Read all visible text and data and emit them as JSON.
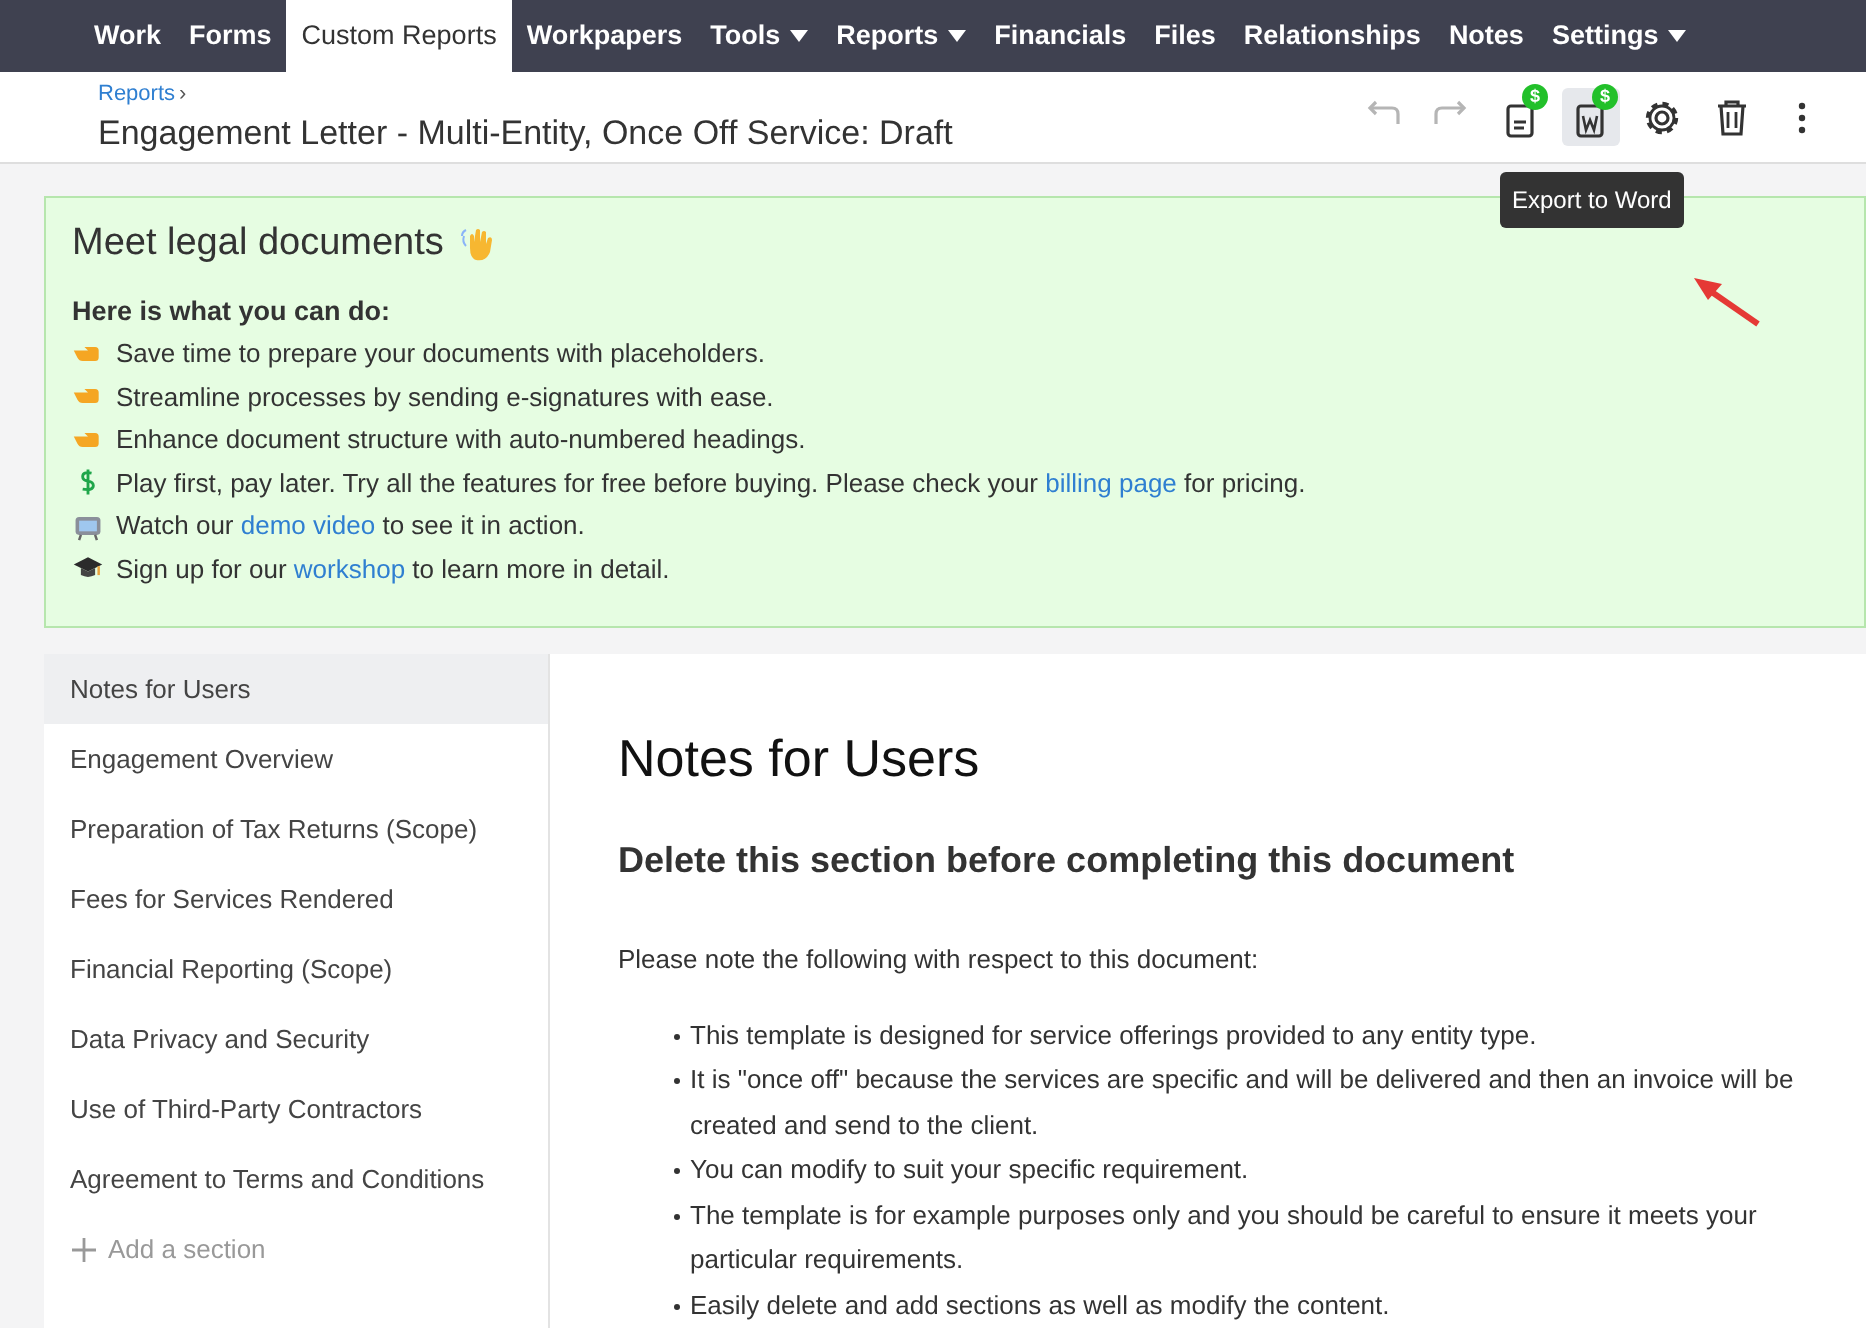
{
  "nav": [
    {
      "label": "Work",
      "selected": false,
      "dropdown": false
    },
    {
      "label": "Forms",
      "selected": false,
      "dropdown": false
    },
    {
      "label": "Custom Reports",
      "selected": true,
      "dropdown": false
    },
    {
      "label": "Workpapers",
      "selected": false,
      "dropdown": false
    },
    {
      "label": "Tools",
      "selected": false,
      "dropdown": true
    },
    {
      "label": "Reports",
      "selected": false,
      "dropdown": true
    },
    {
      "label": "Financials",
      "selected": false,
      "dropdown": false
    },
    {
      "label": "Files",
      "selected": false,
      "dropdown": false
    },
    {
      "label": "Relationships",
      "selected": false,
      "dropdown": false
    },
    {
      "label": "Notes",
      "selected": false,
      "dropdown": false
    },
    {
      "label": "Settings",
      "selected": false,
      "dropdown": true
    }
  ],
  "header": {
    "breadcrumb": "Reports",
    "breadcrumb_separator": "›",
    "title": "Engagement Letter - Multi-Entity, Once Off Service: Draft",
    "toolbar": [
      {
        "kind": "undo",
        "disabled": true,
        "selected": false
      },
      {
        "kind": "redo",
        "disabled": true,
        "selected": false
      },
      {
        "kind": "pdf",
        "disabled": false,
        "selected": false,
        "badge": "$"
      },
      {
        "kind": "word",
        "disabled": false,
        "selected": true,
        "badge": "$"
      },
      {
        "kind": "settings",
        "disabled": false,
        "selected": false
      },
      {
        "kind": "delete",
        "disabled": false,
        "selected": false
      },
      {
        "kind": "more",
        "disabled": false,
        "selected": false
      }
    ],
    "tooltip": "Export to Word"
  },
  "banner": {
    "title": "Meet legal documents",
    "subtitle": "Here is what you can do:",
    "items": [
      {
        "kind": "point",
        "before": "Save time to prepare your documents with placeholders."
      },
      {
        "kind": "point",
        "before": "Streamline processes by sending e-signatures with ease."
      },
      {
        "kind": "point",
        "before": "Enhance document structure with auto-numbered headings."
      },
      {
        "kind": "dollar",
        "before": "Play first, pay later. Try all the features for free before buying. Please check your",
        "link": "billing page",
        "after": "for pricing."
      },
      {
        "kind": "tv",
        "before": "Watch our",
        "link": "demo video",
        "after": "to see it in action."
      },
      {
        "kind": "cap",
        "before": "Sign up for our",
        "link": "workshop",
        "after": "to learn more in detail."
      }
    ]
  },
  "sections": [
    {
      "label": "Notes for Users",
      "selected": true
    },
    {
      "label": "Engagement Overview",
      "selected": false
    },
    {
      "label": "Preparation of Tax Returns (Scope)",
      "selected": false
    },
    {
      "label": "Fees for Services Rendered",
      "selected": false
    },
    {
      "label": "Financial Reporting (Scope)",
      "selected": false
    },
    {
      "label": "Data Privacy and Security",
      "selected": false
    },
    {
      "label": "Use of Third-Party Contractors",
      "selected": false
    },
    {
      "label": "Agreement to Terms and Conditions",
      "selected": false
    }
  ],
  "add_section": "Add a section",
  "document": {
    "heading": "Notes for Users",
    "subheading": "Delete this section before completing this document",
    "intro": "Please note the following with respect to this document:",
    "bullets": [
      "This template is designed for service offerings provided to any entity type.",
      "It is \"once off\" because the services are specific and will be delivered and then an invoice will be created and send to the client.",
      "You can modify to suit your specific requirement.",
      "The template is for example purposes only and you should be careful to ensure it meets your particular requirements.",
      "Easily delete and add sections as well as modify the content."
    ]
  }
}
